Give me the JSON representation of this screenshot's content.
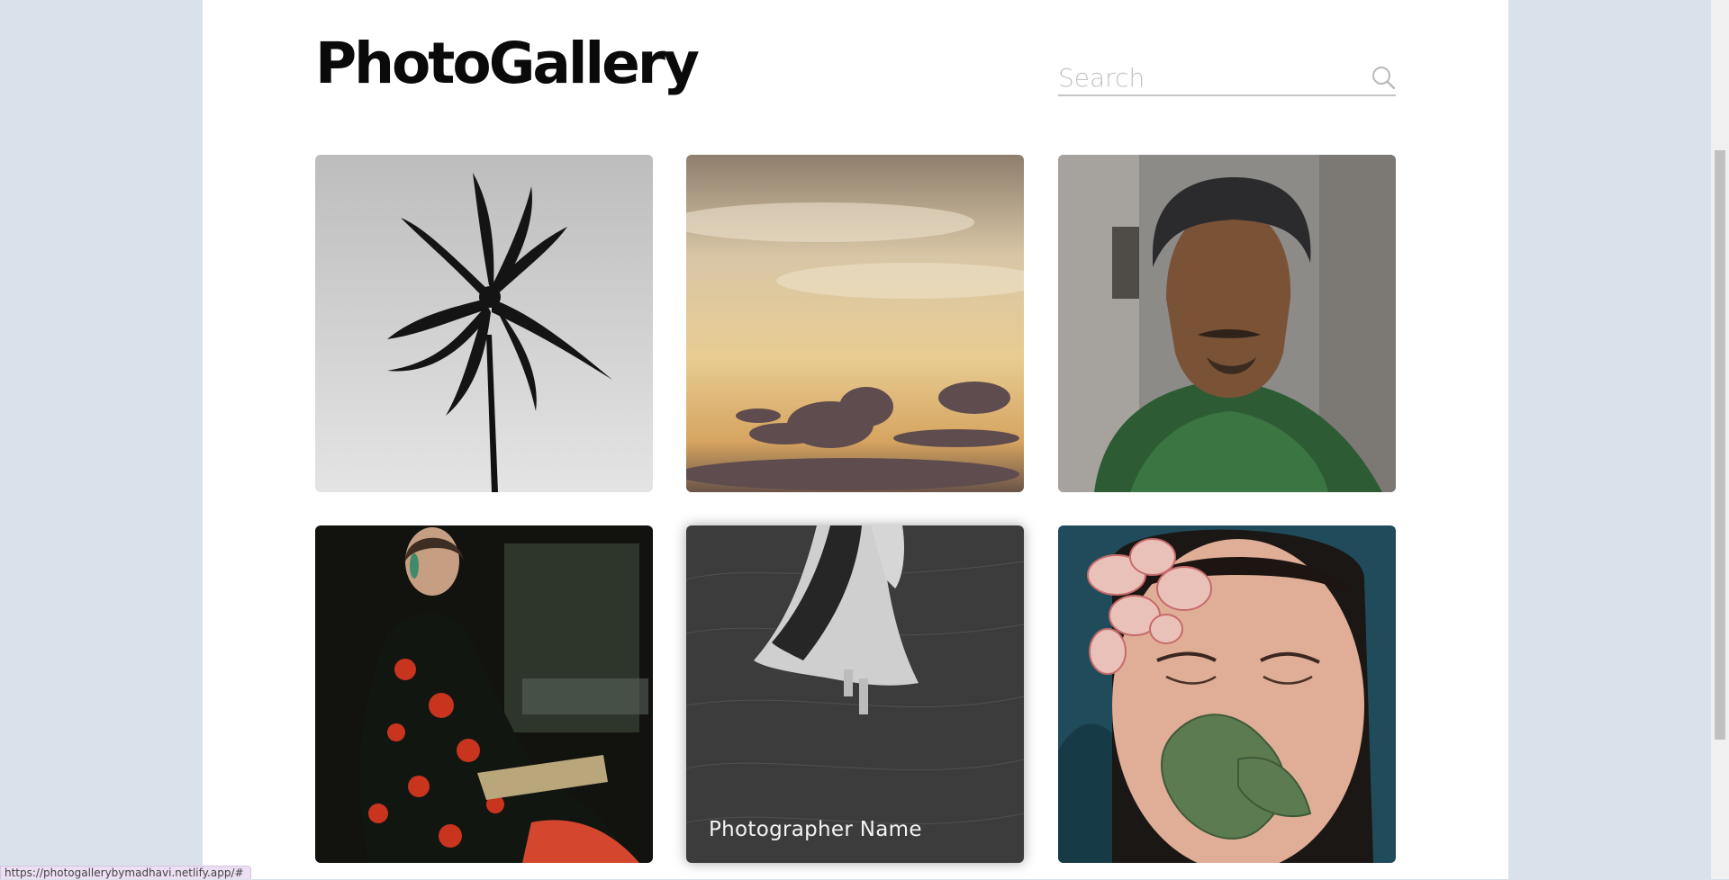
{
  "header": {
    "title": "PhotoGallery",
    "search_placeholder": "Search",
    "search_icon": "search-icon"
  },
  "gallery": {
    "cards": [
      {
        "subject": "palm tree silhouette"
      },
      {
        "subject": "sunset clouds"
      },
      {
        "subject": "man in turban and green scarf"
      },
      {
        "subject": "woman in floral dress holding book"
      },
      {
        "subject": "woman in white dress walking in grass",
        "caption": "Photographer Name"
      },
      {
        "subject": "woman with flower petals on face"
      }
    ]
  },
  "status_bar": {
    "url": "https://photogallerybymadhavi.netlify.app/#"
  },
  "colors": {
    "background": "#d9e1ea",
    "page": "#ffffff",
    "title": "#0a0a0a",
    "placeholder": "#c2c2c2"
  }
}
